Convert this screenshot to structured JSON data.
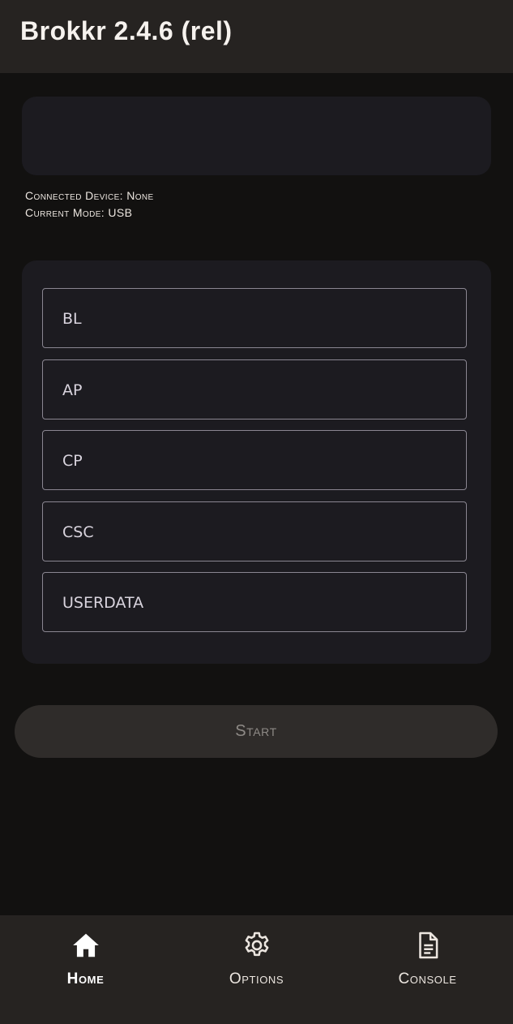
{
  "app": {
    "title": "Brokkr 2.4.6 (rel)"
  },
  "status": {
    "connected_device": "Connected Device: None",
    "current_mode": "Current Mode: USB"
  },
  "files": [
    {
      "label": "BL"
    },
    {
      "label": "AP"
    },
    {
      "label": "CP"
    },
    {
      "label": "CSC"
    },
    {
      "label": "USERDATA"
    }
  ],
  "actions": {
    "start_label": "Start"
  },
  "nav": {
    "items": [
      {
        "label": "Home",
        "icon": "home-icon",
        "active": true
      },
      {
        "label": "Options",
        "icon": "gear-icon",
        "active": false
      },
      {
        "label": "Console",
        "icon": "document-icon",
        "active": false
      }
    ]
  },
  "colors": {
    "background": "#121110",
    "bar": "#262321",
    "card": "#1c1b20",
    "field_border": "#8a8691",
    "button": "#2f2c2a",
    "button_text": "#8e8a86"
  }
}
